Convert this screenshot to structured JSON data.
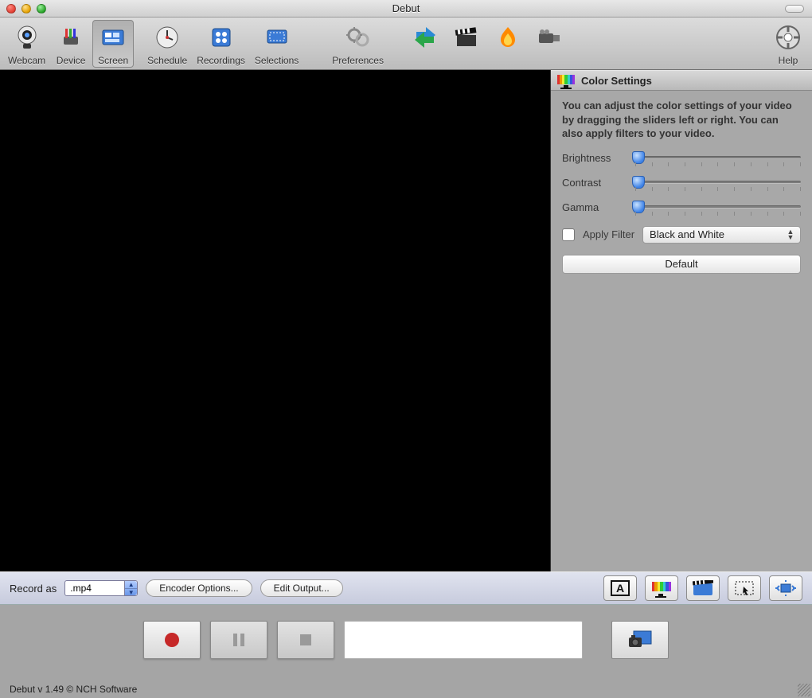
{
  "window": {
    "title": "Debut"
  },
  "toolbar": {
    "items": [
      {
        "id": "webcam",
        "label": "Webcam"
      },
      {
        "id": "device",
        "label": "Device"
      },
      {
        "id": "screen",
        "label": "Screen",
        "selected": true
      },
      {
        "id": "schedule",
        "label": "Schedule"
      },
      {
        "id": "recordings",
        "label": "Recordings"
      },
      {
        "id": "selections",
        "label": "Selections"
      },
      {
        "id": "preferences",
        "label": "Preferences"
      }
    ],
    "extra_icons": [
      "share-icon",
      "clapper-icon",
      "burn-icon",
      "camcorder-icon"
    ],
    "help_label": "Help"
  },
  "sidebar": {
    "panel_title": "Color Settings",
    "description": "You can adjust the color settings of your video by dragging the sliders left or right. You can also apply filters to your video.",
    "sliders": {
      "brightness": {
        "label": "Brightness",
        "value": 0
      },
      "contrast": {
        "label": "Contrast",
        "value": 0
      },
      "gamma": {
        "label": "Gamma",
        "value": 0
      }
    },
    "apply_filter": {
      "label": "Apply Filter",
      "checked": false
    },
    "filter_select": {
      "value": "Black and White"
    },
    "default_button": "Default"
  },
  "recordbar": {
    "label": "Record as",
    "format": ".mp4",
    "encoder_button": "Encoder Options...",
    "edit_output_button": "Edit Output...",
    "tool_icons": [
      "text-overlay-icon",
      "color-settings-icon",
      "video-effects-icon",
      "select-region-icon",
      "fullscreen-icon"
    ]
  },
  "controls": {
    "record": "record-button",
    "pause": "pause-button",
    "stop": "stop-button",
    "snapshot": "snapshot-button"
  },
  "footer": "Debut v 1.49 © NCH Software"
}
